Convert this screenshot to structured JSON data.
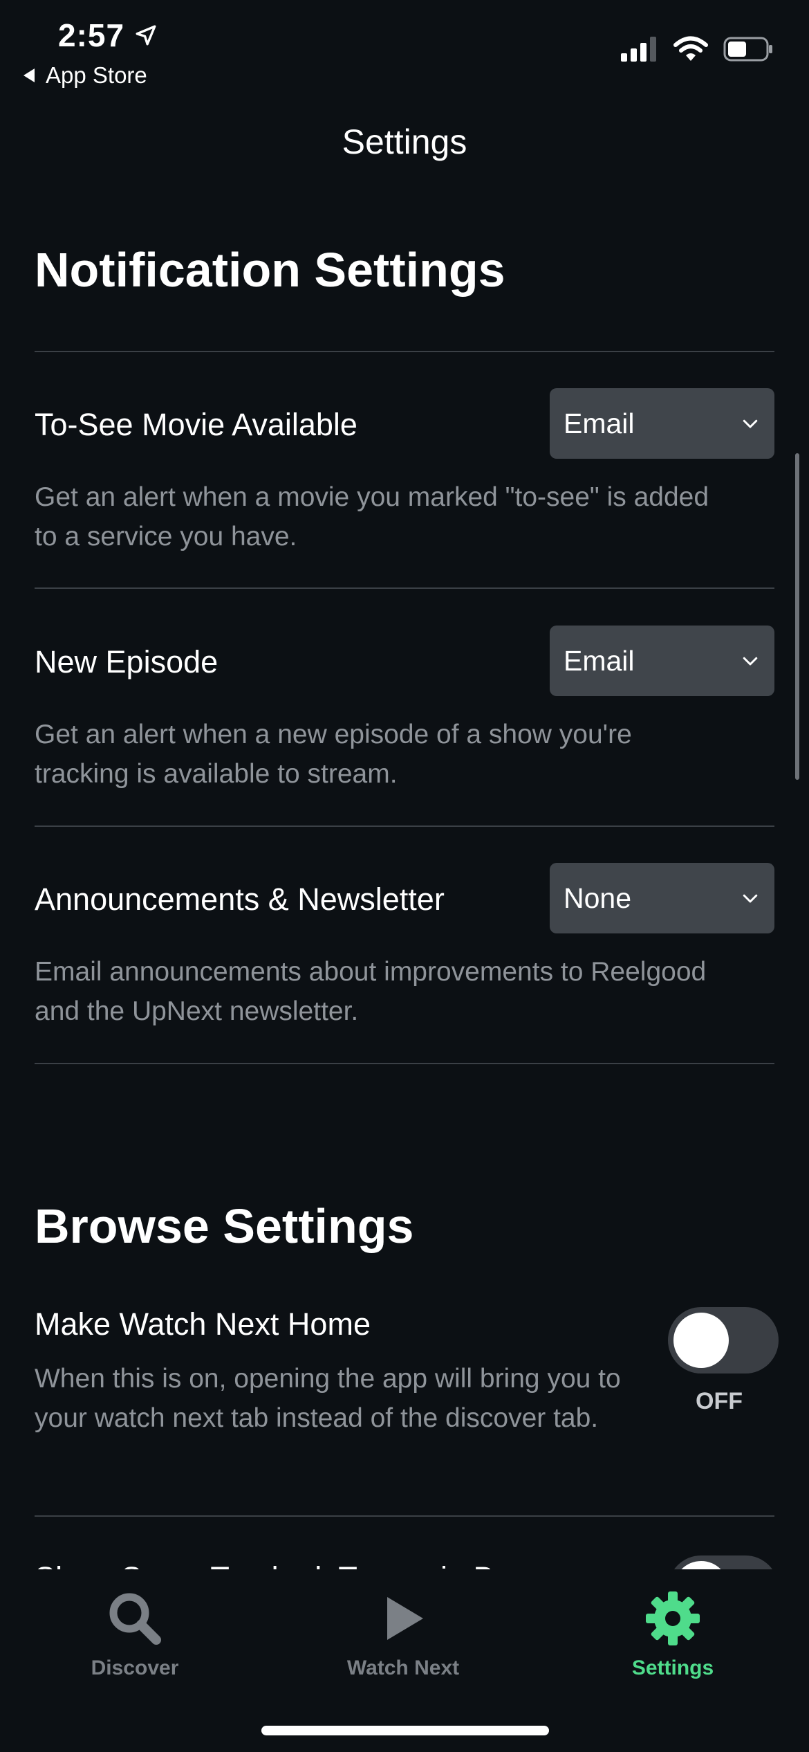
{
  "status_bar": {
    "time": "2:57",
    "back_label": "App Store"
  },
  "header": {
    "title": "Settings"
  },
  "notification_settings": {
    "title": "Notification Settings",
    "rows": [
      {
        "label": "To-See Movie Available",
        "value": "Email",
        "description": "Get an alert when a movie you marked \"to-see\" is added to a service you have."
      },
      {
        "label": "New Episode",
        "value": "Email",
        "description": "Get an alert when a new episode of a show you're tracking is available to stream."
      },
      {
        "label": "Announcements & Newsletter",
        "value": "None",
        "description": "Email announcements about improvements to Reelgood and the UpNext newsletter."
      }
    ]
  },
  "browse_settings": {
    "title": "Browse Settings",
    "rows": [
      {
        "label": "Make Watch Next Home",
        "description": "When this is on, opening the app will bring you to your watch next tab instead of the discover tab.",
        "state": "OFF"
      },
      {
        "label": "Show Seen, Tracked, To-see in Browse"
      }
    ]
  },
  "tabbar": {
    "tabs": [
      {
        "label": "Discover",
        "icon": "search-icon",
        "active": false
      },
      {
        "label": "Watch Next",
        "icon": "play-icon",
        "active": false
      },
      {
        "label": "Settings",
        "icon": "gear-icon",
        "active": true
      }
    ]
  },
  "colors": {
    "background": "#0c1014",
    "accent": "#4fdc8b",
    "dropdown_bg": "#40454b",
    "muted_text": "#8f949a"
  }
}
